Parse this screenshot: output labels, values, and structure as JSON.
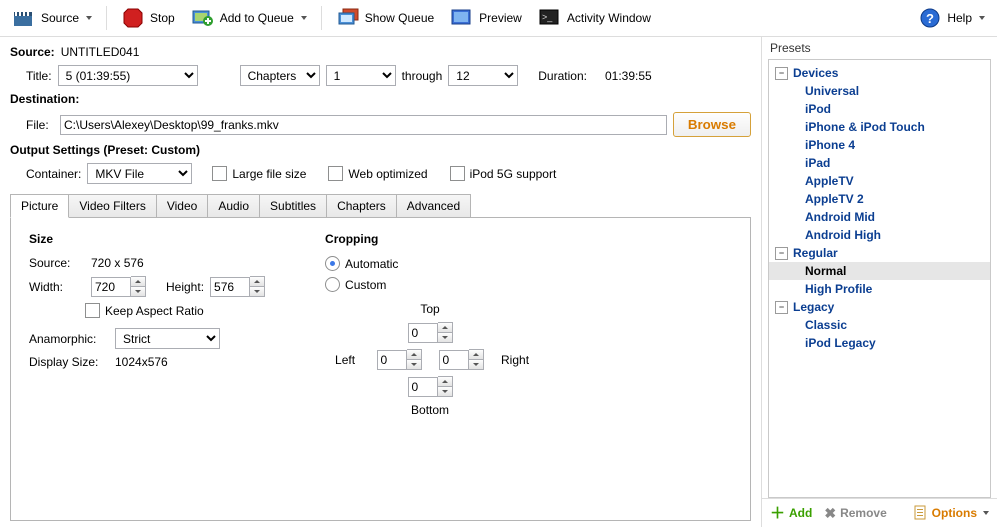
{
  "toolbar": {
    "source": "Source",
    "stop": "Stop",
    "add_queue": "Add to Queue",
    "show_queue": "Show Queue",
    "preview": "Preview",
    "activity": "Activity Window",
    "help": "Help"
  },
  "source": {
    "label": "Source:",
    "value": "UNTITLED041",
    "title_label": "Title:",
    "title_value": "5 (01:39:55)",
    "range_type": "Chapters",
    "range_from": "1",
    "through_label": "through",
    "range_to": "12",
    "duration_label": "Duration:",
    "duration_value": "01:39:55"
  },
  "destination": {
    "label": "Destination:",
    "file_label": "File:",
    "file_value": "C:\\Users\\Alexey\\Desktop\\99_franks.mkv",
    "browse": "Browse"
  },
  "output": {
    "heading": "Output Settings (Preset: Custom)",
    "container_label": "Container:",
    "container_value": "MKV File",
    "large_file": "Large file size",
    "web_opt": "Web optimized",
    "ipod5g": "iPod 5G support"
  },
  "tabs": [
    "Picture",
    "Video Filters",
    "Video",
    "Audio",
    "Subtitles",
    "Chapters",
    "Advanced"
  ],
  "picture": {
    "size_heading": "Size",
    "source_label": "Source:",
    "source_value": "720 x 576",
    "width_label": "Width:",
    "width_value": "720",
    "height_label": "Height:",
    "height_value": "576",
    "keep_ar": "Keep Aspect Ratio",
    "anam_label": "Anamorphic:",
    "anam_value": "Strict",
    "disp_label": "Display Size:",
    "disp_value": "1024x576",
    "crop_heading": "Cropping",
    "auto": "Automatic",
    "custom": "Custom",
    "top": "Top",
    "left": "Left",
    "right": "Right",
    "bottom": "Bottom",
    "crop_top": "0",
    "crop_left": "0",
    "crop_right": "0",
    "crop_bottom": "0"
  },
  "presets": {
    "title": "Presets",
    "groups": [
      {
        "name": "Devices",
        "items": [
          "Universal",
          "iPod",
          "iPhone & iPod Touch",
          "iPhone 4",
          "iPad",
          "AppleTV",
          "AppleTV 2",
          "Android Mid",
          "Android High"
        ]
      },
      {
        "name": "Regular",
        "items": [
          "Normal",
          "High Profile"
        ]
      },
      {
        "name": "Legacy",
        "items": [
          "Classic",
          "iPod Legacy"
        ]
      }
    ],
    "selected": "Normal",
    "add": "Add",
    "remove": "Remove",
    "options": "Options"
  }
}
